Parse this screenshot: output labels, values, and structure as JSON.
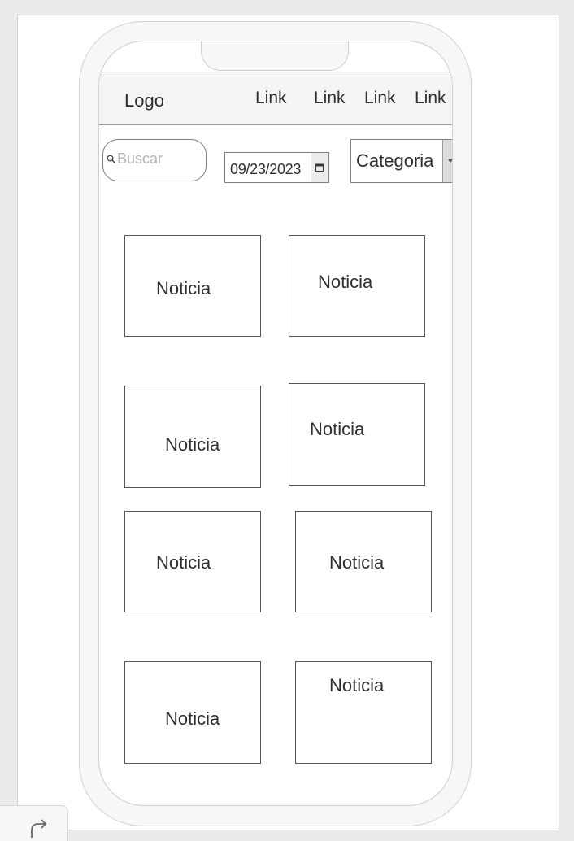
{
  "navbar": {
    "logo": "Logo",
    "links": [
      "Link",
      "Link",
      "Link",
      "Link"
    ]
  },
  "filters": {
    "search_placeholder": "Buscar",
    "date_value": "09/23/2023",
    "category_label": "Categoria"
  },
  "news": {
    "cards": [
      "Noticia",
      "Noticia",
      "Noticia",
      "Noticia",
      "Noticia",
      "Noticia",
      "Noticia",
      "Noticia"
    ]
  },
  "icons": {
    "search": "search-icon",
    "calendar": "calendar-icon",
    "dropdown": "chevron-down-icon",
    "redo": "redo-icon"
  },
  "colors": {
    "canvas_bg": "#ebebeb",
    "navbar_bg": "#f5f5f5",
    "border": "#7f7f7f",
    "text": "#2f2f2f",
    "placeholder": "#b3b3b3"
  }
}
